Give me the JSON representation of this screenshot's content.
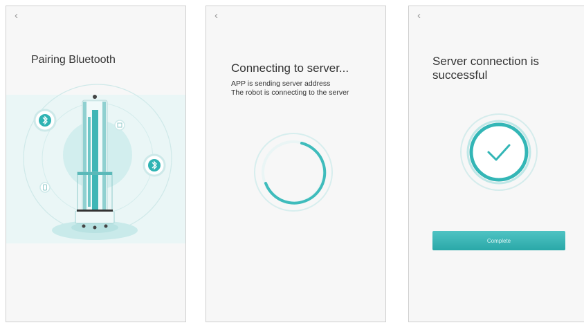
{
  "screens": [
    {
      "back_icon": "‹",
      "title": "Pairing Bluetooth"
    },
    {
      "back_icon": "‹",
      "title": "Connecting to server...",
      "lines": [
        "APP is sending server address",
        "The robot is connecting to the server"
      ]
    },
    {
      "back_icon": "‹",
      "title": "Server connection is successful",
      "button_label": "Complete"
    }
  ],
  "colors": {
    "accent": "#2fb3b3",
    "accent_light": "#bfe8e8",
    "panel_bg": "#f7f7f7",
    "text": "#333333"
  },
  "icons": [
    "back-chevron-icon",
    "bluetooth-icon",
    "device-icon",
    "uv-robot-illustration",
    "spinner-icon",
    "checkmark-icon"
  ]
}
